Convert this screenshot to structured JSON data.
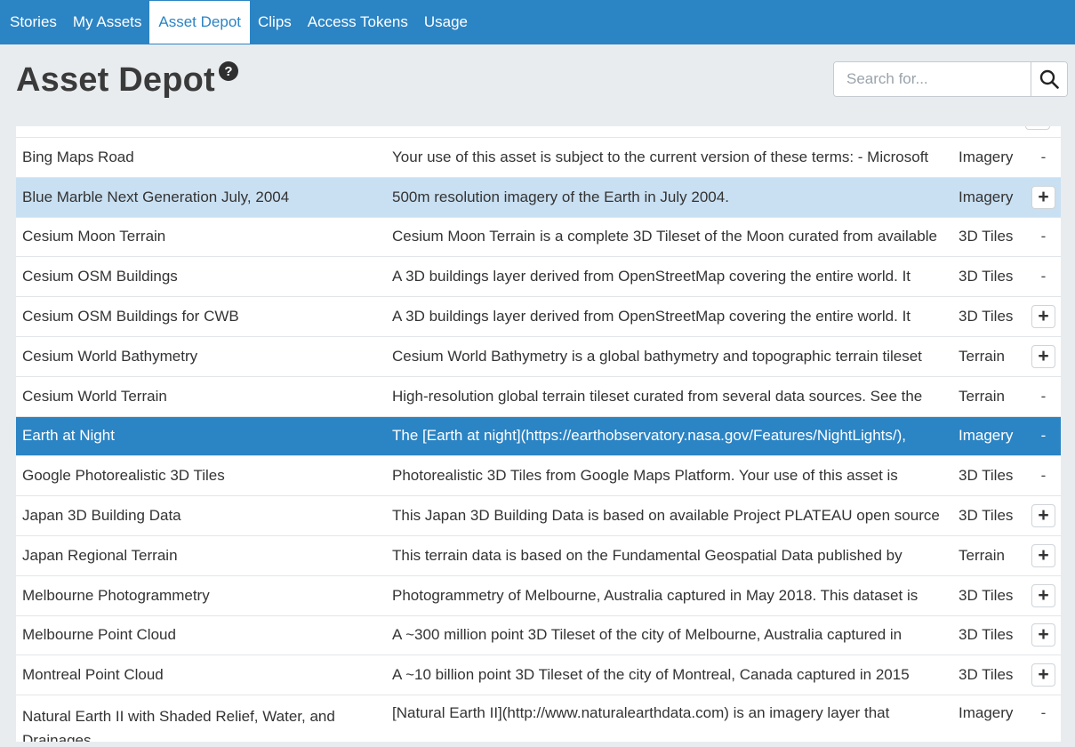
{
  "nav": {
    "tabs": [
      {
        "label": "Stories"
      },
      {
        "label": "My Assets"
      },
      {
        "label": "Asset Depot"
      },
      {
        "label": "Clips"
      },
      {
        "label": "Access Tokens"
      },
      {
        "label": "Usage"
      }
    ],
    "active_tab": "Asset Depot"
  },
  "header": {
    "title": "Asset Depot",
    "help_glyph": "?"
  },
  "search": {
    "placeholder": "Search for...",
    "value": ""
  },
  "table": {
    "rows": [
      {
        "name": "Bing Maps Road",
        "description": "Your use of this asset is subject to the current version of these terms: - Microsoft",
        "type": "Imagery",
        "action": "-"
      },
      {
        "name": "Blue Marble Next Generation July, 2004",
        "description": "500m resolution imagery of the Earth in July 2004.",
        "type": "Imagery",
        "action": "+"
      },
      {
        "name": "Cesium Moon Terrain",
        "description": "Cesium Moon Terrain is a complete 3D Tileset of the Moon curated from available",
        "type": "3D Tiles",
        "action": "-"
      },
      {
        "name": "Cesium OSM Buildings",
        "description": "A 3D buildings layer derived from OpenStreetMap covering the entire world. It",
        "type": "3D Tiles",
        "action": "-"
      },
      {
        "name": "Cesium OSM Buildings for CWB",
        "description": "A 3D buildings layer derived from OpenStreetMap covering the entire world. It",
        "type": "3D Tiles",
        "action": "+"
      },
      {
        "name": "Cesium World Bathymetry",
        "description": "Cesium World Bathymetry is a global bathymetry and topographic terrain tileset",
        "type": "Terrain",
        "action": "+"
      },
      {
        "name": "Cesium World Terrain",
        "description": "High-resolution global terrain tileset curated from several data sources. See the",
        "type": "Terrain",
        "action": "-"
      },
      {
        "name": "Earth at Night",
        "description": "The [Earth at night](https://earthobservatory.nasa.gov/Features/NightLights/),",
        "type": "Imagery",
        "action": "-"
      },
      {
        "name": "Google Photorealistic 3D Tiles",
        "description": "Photorealistic 3D Tiles from Google Maps Platform. Your use of this asset is",
        "type": "3D Tiles",
        "action": "-"
      },
      {
        "name": "Japan 3D Building Data",
        "description": "This Japan 3D Building Data is based on available Project PLATEAU open source",
        "type": "3D Tiles",
        "action": "+"
      },
      {
        "name": "Japan Regional Terrain",
        "description": "This terrain data is based on the Fundamental Geospatial Data published by",
        "type": "Terrain",
        "action": "+"
      },
      {
        "name": "Melbourne Photogrammetry",
        "description": "Photogrammetry of Melbourne, Australia captured in May 2018. This dataset is",
        "type": "3D Tiles",
        "action": "+"
      },
      {
        "name": "Melbourne Point Cloud",
        "description": "A ~300 million point 3D Tileset of the city of Melbourne, Australia captured in",
        "type": "3D Tiles",
        "action": "+"
      },
      {
        "name": "Montreal Point Cloud",
        "description": "A ~10 billion point 3D Tileset of the city of Montreal, Canada captured in 2015",
        "type": "3D Tiles",
        "action": "+"
      },
      {
        "name": "Natural Earth II with Shaded Relief, Water, and Drainages",
        "description": "[Natural Earth II](http://www.naturalearthdata.com) is an imagery layer that",
        "type": "Imagery",
        "action": "-"
      }
    ],
    "hover_row": "Blue Marble Next Generation July, 2004",
    "selected_row": "Earth at Night"
  },
  "colors": {
    "accent": "#2b84c4",
    "hover_row": "#c9e0f2",
    "background": "#e8ecef"
  }
}
